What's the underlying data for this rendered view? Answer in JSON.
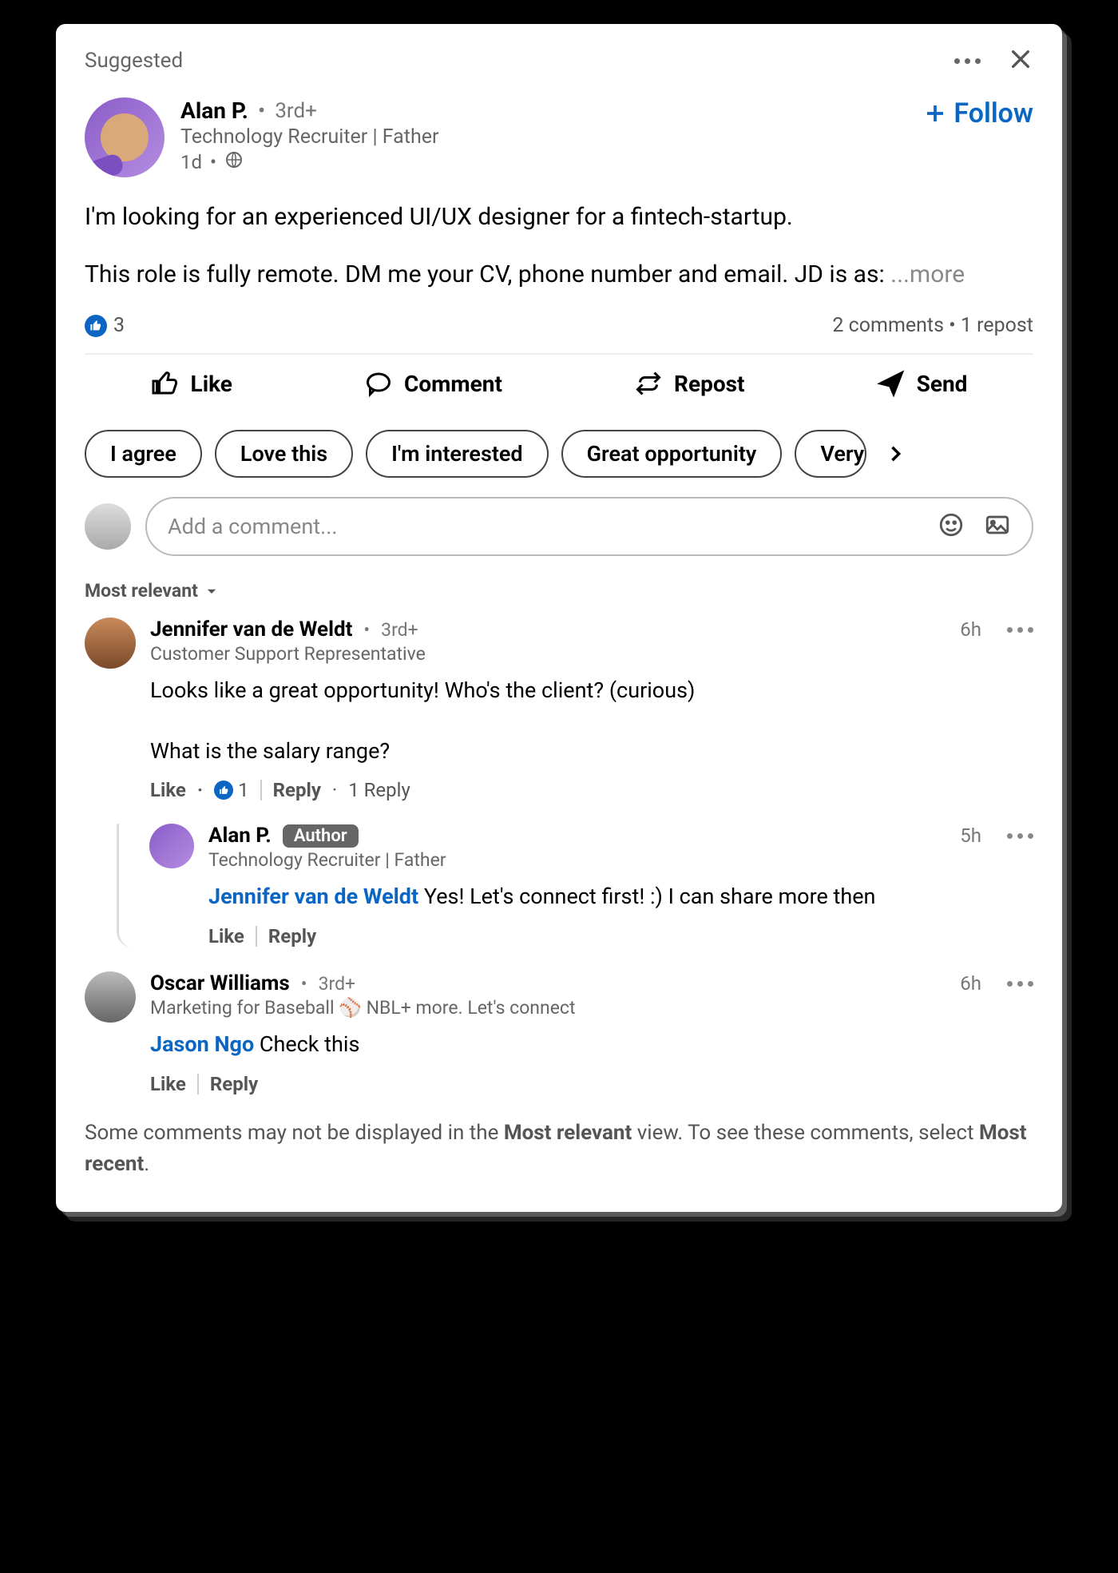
{
  "topbar": {
    "label": "Suggested"
  },
  "post": {
    "author": {
      "name": "Alan P.",
      "degree": "3rd+",
      "headline": "Technology Recruiter | Father",
      "time": "1d"
    },
    "follow_label": "Follow",
    "body_line1": "I'm looking for an experienced UI/UX designer for a fintech-startup.",
    "body_line2": "This role is fully remote. DM me your CV, phone number and email. JD is as: ",
    "more_label": "...more",
    "reactions_count": "3",
    "comments_label": "2 comments",
    "reposts_label": "1 repost"
  },
  "actions": {
    "like": "Like",
    "comment": "Comment",
    "repost": "Repost",
    "send": "Send"
  },
  "chips": [
    "I agree",
    "Love this",
    "I'm interested",
    "Great opportunity",
    "Very"
  ],
  "comment_input": {
    "placeholder": "Add a comment..."
  },
  "sort": {
    "label": "Most relevant"
  },
  "comments": [
    {
      "name": "Jennifer van de Weldt",
      "degree": "3rd+",
      "time": "6h",
      "headline": "Customer Support Representative",
      "text_line1": "Looks like a great opportunity! Who's the client? (curious)",
      "text_line2": "What is the salary range?",
      "like_label": "Like",
      "like_count": "1",
      "reply_label": "Reply",
      "reply_count_label": "1 Reply",
      "reply": {
        "name": "Alan P.",
        "badge": "Author",
        "time": "5h",
        "headline": "Technology Recruiter | Father",
        "mention": "Jennifer van de Weldt",
        "text": " Yes! Let's connect first! :) I can share more then",
        "like_label": "Like",
        "reply_label": "Reply"
      }
    },
    {
      "name": "Oscar Williams",
      "degree": "3rd+",
      "time": "6h",
      "headline": "Marketing for Baseball ⚾ NBL+ more. Let's connect",
      "mention": "Jason Ngo",
      "text": " Check this",
      "like_label": "Like",
      "reply_label": "Reply"
    }
  ],
  "footer": {
    "part1": "Some comments may not be displayed in the ",
    "bold1": "Most relevant",
    "part2": " view. To see these comments, select ",
    "bold2": "Most recent",
    "part3": "."
  }
}
